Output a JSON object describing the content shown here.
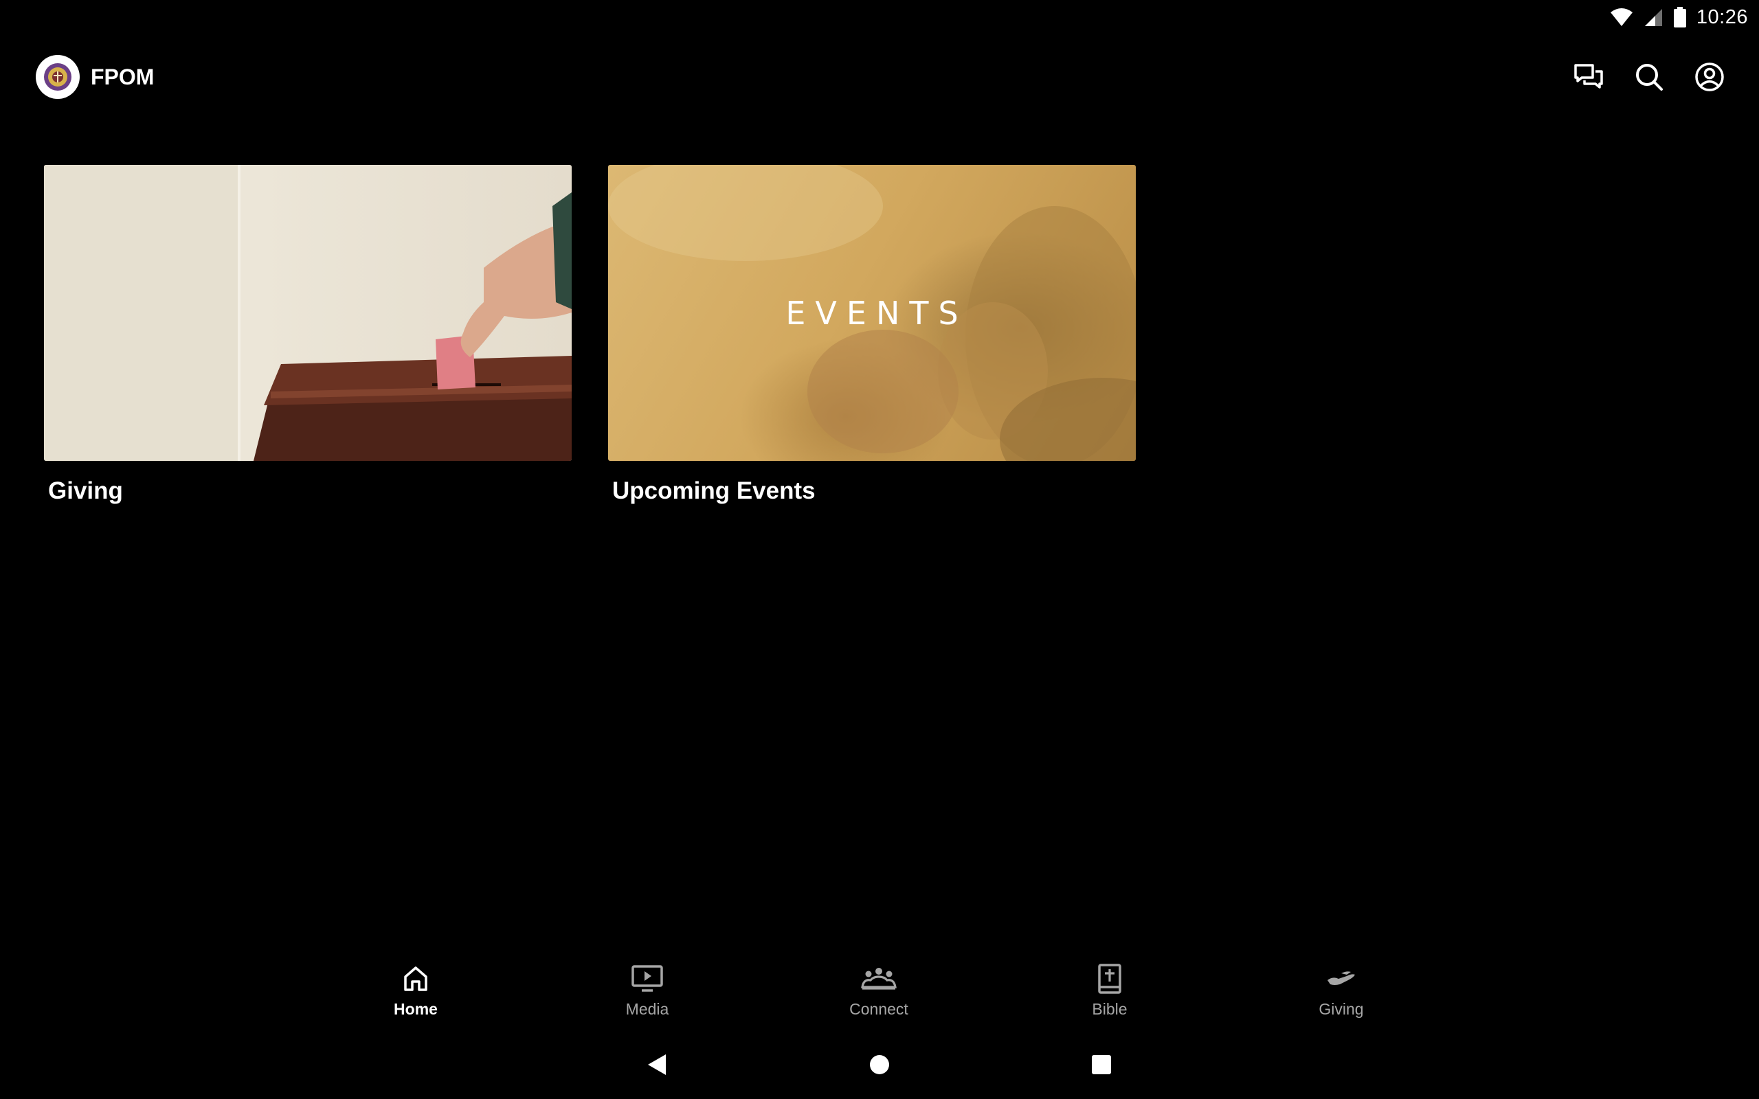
{
  "status_bar": {
    "time": "10:26",
    "icons": [
      "wifi-icon",
      "cell-signal-icon",
      "battery-icon"
    ]
  },
  "app_bar": {
    "title": "FPOM",
    "logo": "church-logo",
    "actions": [
      "chat-icon",
      "search-icon",
      "account-icon"
    ]
  },
  "cards": [
    {
      "title": "Giving",
      "image": "hand placing money into wooden offering box"
    },
    {
      "title": "Upcoming Events",
      "overlay_text": "EVENTS"
    }
  ],
  "bottom_nav": {
    "items": [
      {
        "label": "Home",
        "icon": "home-icon",
        "active": true
      },
      {
        "label": "Media",
        "icon": "tv-play-icon",
        "active": false
      },
      {
        "label": "Connect",
        "icon": "people-group-icon",
        "active": false
      },
      {
        "label": "Bible",
        "icon": "bible-icon",
        "active": false
      },
      {
        "label": "Giving",
        "icon": "giving-hand-icon",
        "active": false
      }
    ]
  },
  "system_nav": [
    "back-icon",
    "home-circle-icon",
    "recents-icon"
  ],
  "colors": {
    "background": "#000000",
    "text": "#ffffff",
    "inactive_nav": "#a6a6a6",
    "events_tint": "#c9a05a"
  }
}
